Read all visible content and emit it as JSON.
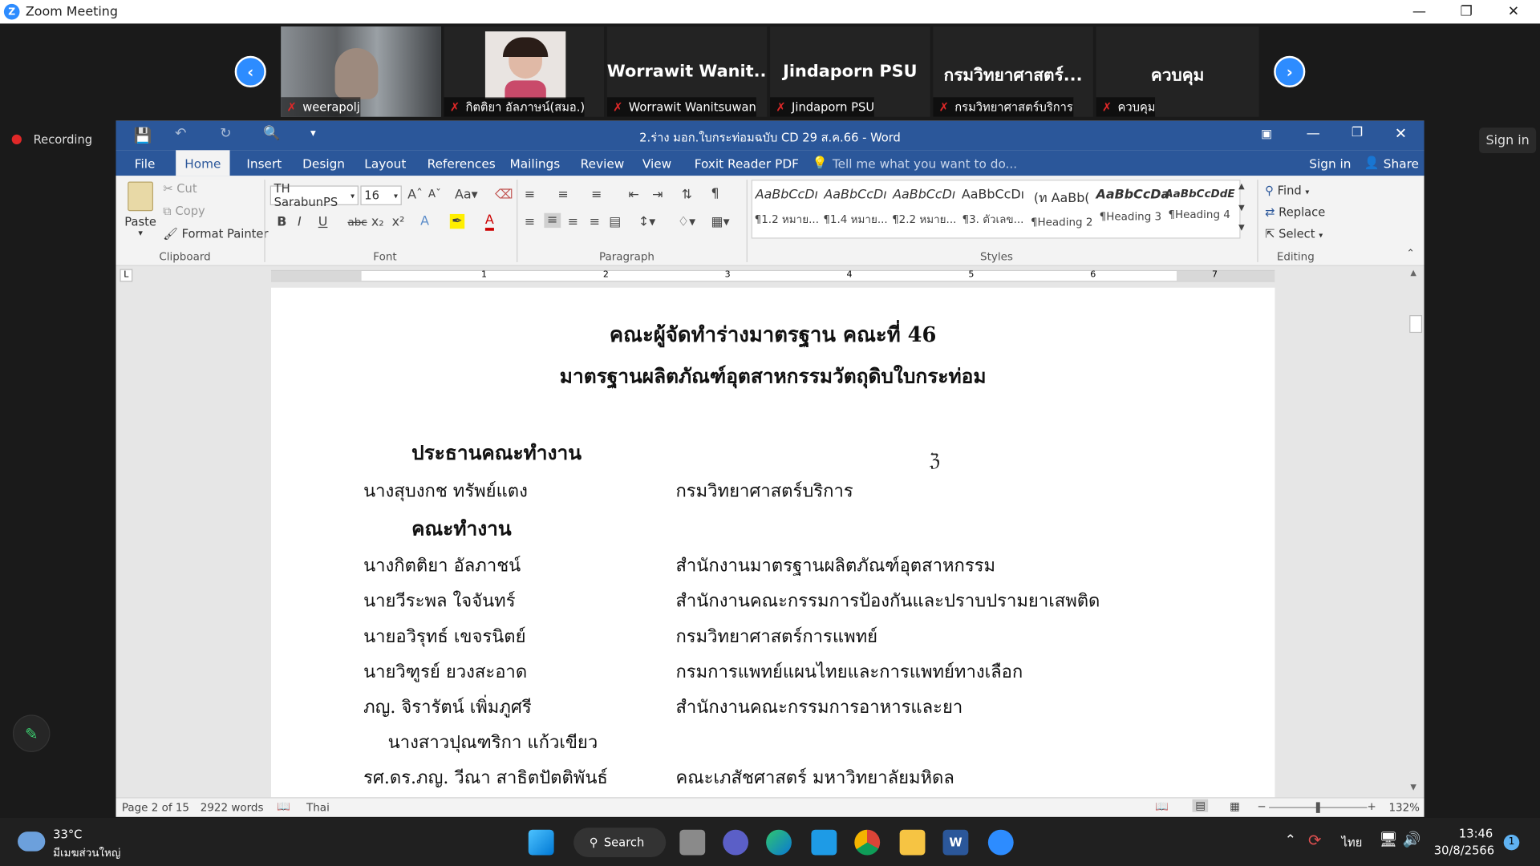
{
  "zoom": {
    "title": "Zoom Meeting",
    "recording": "Recording",
    "sign_in": "Sign in",
    "participants": [
      {
        "header": "",
        "label": "weerapolj"
      },
      {
        "header": "",
        "label": "กิตติยา อัลภาษน์(สมอ.)"
      },
      {
        "header": "Worrawit  Wanit...",
        "label": "Worrawit Wanitsuwan"
      },
      {
        "header": "Jindaporn PSU",
        "label": "Jindaporn PSU"
      },
      {
        "header": "กรมวิทยาศาสตร์...",
        "label": "กรมวิทยาศาสตร์บริการ"
      },
      {
        "header": "ควบคุม",
        "label": "ควบคุม"
      }
    ]
  },
  "word": {
    "title": "2.ร่าง มอก.ใบกระท่อมฉบับ CD 29 ส.ค.66 - Word",
    "tabs": [
      "File",
      "Home",
      "Insert",
      "Design",
      "Layout",
      "References",
      "Mailings",
      "Review",
      "View",
      "Foxit Reader PDF"
    ],
    "tell_me": "Tell me what you want to do...",
    "sign_in": "Sign in",
    "share": "Share",
    "clipboard": {
      "paste": "Paste",
      "cut": "Cut",
      "copy": "Copy",
      "format_painter": "Format Painter",
      "group": "Clipboard"
    },
    "font": {
      "name": "TH SarabunPS",
      "size": "16",
      "group": "Font"
    },
    "paragraph_group": "Paragraph",
    "styles": [
      {
        "preview": "AaBbCcDı",
        "name": "¶1.2 หมาย..."
      },
      {
        "preview": "AaBbCcDı",
        "name": "¶1.4 หมาย..."
      },
      {
        "preview": "AaBbCcDı",
        "name": "¶2.2 หมาย..."
      },
      {
        "preview": "AaBbCcDı",
        "name": "¶3. ตัวเลข..."
      },
      {
        "preview": "(ท  AaBb(",
        "name": "¶Heading 2"
      },
      {
        "preview": "AaBbCcDa",
        "name": "¶Heading 3"
      },
      {
        "preview": "AaBbCcDdE",
        "name": "¶Heading 4"
      }
    ],
    "styles_group": "Styles",
    "editing": {
      "find": "Find",
      "replace": "Replace",
      "select": "Select",
      "group": "Editing"
    },
    "ruler_numbers": [
      "1",
      "2",
      "3",
      "4",
      "5",
      "6",
      "7"
    ],
    "document": {
      "heading1": "คณะผู้จัดทำร่างมาตรฐาน คณะที่ 46",
      "heading2": "มาตรฐานผลิตภัณฑ์อุตสาหกรรมวัตถุดิบใบกระท่อม",
      "section1": "ประธานคณะทำงาน",
      "chair": {
        "name": "นางสุบงกช  ทรัพย์แตง",
        "org": "กรมวิทยาศาสตร์บริการ"
      },
      "section2": "คณะทำงาน",
      "members": [
        {
          "name": "นางกิตติยา  อัลภาชน์",
          "org": "สำนักงานมาตรฐานผลิตภัณฑ์อุตสาหกรรม"
        },
        {
          "name": "นายวีระพล  ใจจันทร์",
          "org": "สำนักงานคณะกรรมการป้องกันและปราบปรามยาเสพติด"
        },
        {
          "name": "นายอวิรุทธ์  เขจรนิตย์",
          "org": "กรมวิทยาศาสตร์การแพทย์"
        },
        {
          "name": "นายวิฑูรย์  ยวงสะอาด",
          "org": "กรมการแพทย์แผนไทยและการแพทย์ทางเลือก"
        },
        {
          "name": "ภญ. จิรารัตน์  เพิ่มภูศรี",
          "org": "สำนักงานคณะกรรมการอาหารและยา"
        },
        {
          "name": "นางสาวปุณฑริกา  แก้วเขียว",
          "org": ""
        },
        {
          "name": "รศ.ดร.ภญ. วีณา  สาธิตปัตติพันธ์",
          "org": "คณะเภสัชศาสตร์  มหาวิทยาลัยมหิดล"
        }
      ]
    },
    "status": {
      "page": "Page 2 of 15",
      "words": "2922 words",
      "language": "Thai",
      "zoom": "132%"
    }
  },
  "taskbar": {
    "temp": "33°C",
    "weather": "มีเมฆส่วนใหญ่",
    "search": "Search",
    "lang": "ไทย",
    "time": "13:46",
    "date": "30/8/2566",
    "notif": "1"
  }
}
